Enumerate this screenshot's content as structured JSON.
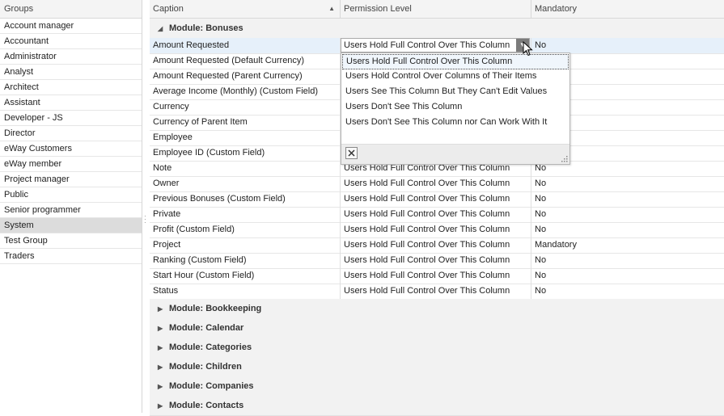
{
  "groups": {
    "header": "Groups",
    "items": [
      "Account manager",
      "Accountant",
      "Administrator",
      "Analyst",
      "Architect",
      "Assistant",
      "Developer - JS",
      "Director",
      "eWay Customers",
      "eWay member",
      "Project manager",
      "Public",
      "Senior programmer",
      "System",
      "Test Group",
      "Traders"
    ],
    "selected": "System"
  },
  "grid": {
    "columns": {
      "caption": "Caption",
      "permission": "Permission Level",
      "mandatory": "Mandatory"
    },
    "expanded_module": "Module: Bonuses",
    "rows": [
      {
        "caption": "Amount Requested",
        "permission": "Users Hold Full Control Over This Column",
        "mandatory": "No"
      },
      {
        "caption": "Amount Requested (Default Currency)",
        "permission": "",
        "mandatory": ""
      },
      {
        "caption": "Amount Requested (Parent Currency)",
        "permission": "",
        "mandatory": ""
      },
      {
        "caption": "Average Income (Monthly) (Custom Field)",
        "permission": "",
        "mandatory": ""
      },
      {
        "caption": "Currency",
        "permission": "",
        "mandatory": ""
      },
      {
        "caption": "Currency of Parent Item",
        "permission": "",
        "mandatory": ""
      },
      {
        "caption": "Employee",
        "permission": "",
        "mandatory": "y"
      },
      {
        "caption": "Employee ID (Custom Field)",
        "permission": "",
        "mandatory": ""
      },
      {
        "caption": "Note",
        "permission": "Users Hold Full Control Over This Column",
        "mandatory": "No"
      },
      {
        "caption": "Owner",
        "permission": "Users Hold Full Control Over This Column",
        "mandatory": "No"
      },
      {
        "caption": "Previous Bonuses (Custom Field)",
        "permission": "Users Hold Full Control Over This Column",
        "mandatory": "No"
      },
      {
        "caption": "Private",
        "permission": "Users Hold Full Control Over This Column",
        "mandatory": "No"
      },
      {
        "caption": "Profit (Custom Field)",
        "permission": "Users Hold Full Control Over This Column",
        "mandatory": "No"
      },
      {
        "caption": "Project",
        "permission": "Users Hold Full Control Over This Column",
        "mandatory": "Mandatory"
      },
      {
        "caption": "Ranking (Custom Field)",
        "permission": "Users Hold Full Control Over This Column",
        "mandatory": "No"
      },
      {
        "caption": "Start Hour (Custom Field)",
        "permission": "Users Hold Full Control Over This Column",
        "mandatory": "No"
      },
      {
        "caption": "Status",
        "permission": "Users Hold Full Control Over This Column",
        "mandatory": "No"
      }
    ],
    "collapsed_modules": [
      "Module: Bookkeeping",
      "Module: Calendar",
      "Module: Categories",
      "Module: Children",
      "Module: Companies",
      "Module: Contacts"
    ]
  },
  "editor": {
    "value": "Users Hold Full Control Over This Column"
  },
  "dropdown": {
    "options": [
      "Users Hold Full Control Over This Column",
      "Users Hold Control Over Columns of Their Items",
      "Users See This Column But They Can't Edit Values",
      "Users Don't See This Column",
      "Users Don't See This Column nor Can Work With It"
    ],
    "highlighted": "Users Hold Full Control Over This Column"
  },
  "icons": {
    "sort_ascending": "sort-ascending-icon",
    "expanded": "triangle-down-icon",
    "collapsed": "triangle-right-icon",
    "dropdown": "chevron-down-icon",
    "close": "close-icon",
    "resize": "resize-grip-icon",
    "cursor": "mouse-cursor-icon"
  }
}
